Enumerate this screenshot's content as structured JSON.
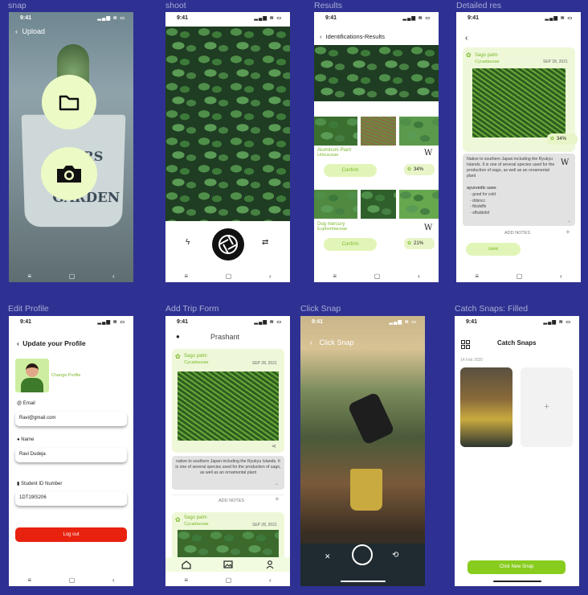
{
  "frames": {
    "snap": "snap",
    "shoot": "shoot",
    "results": "Results",
    "detailed": "Detailed res",
    "edit_profile": "Edit Profile",
    "add_trip": "Add Trip Form",
    "click_snap": "Click Snap",
    "catch_snaps": "Catch Snaps: Filled"
  },
  "status_time": "9:41",
  "status_icons": "▂▄▆ ≋ ▭",
  "nav": {
    "menu": "≡",
    "home": "▢",
    "back": "‹"
  },
  "snap": {
    "back": "‹",
    "title": "Upload",
    "pot_text1": "ERS",
    "pot_text2": "GARDEN"
  },
  "shoot": {
    "flash": "ϟ",
    "flip": "⇄"
  },
  "results": {
    "back": "‹",
    "title": "Identifications-Results",
    "items": [
      {
        "name": "Aluminum Plant",
        "family": "Urticaceae",
        "confirm": "Confirm",
        "pct": "34%",
        "wiki": "W"
      },
      {
        "name": "Dog mercury",
        "family": "Euphorbiaceae",
        "confirm": "Confirm",
        "pct": "21%",
        "wiki": "W"
      }
    ]
  },
  "detail": {
    "back": "‹",
    "name": "Sago palm",
    "family": "Cycadaceae",
    "date": "SEP 28, 2021",
    "pct": "34%",
    "description": "Native to southern Japan including the Ryukyu Islands. It is one of several species used for the production of sago, as well as an ornamental plant",
    "uses_title": "ayurvedic uses",
    "uses": [
      "good for cold",
      "ddsncc",
      "fdsdsffs",
      "sffsddsfsf"
    ],
    "add_notes": "ADD NOTES",
    "plus": "+",
    "save": "save",
    "wiki": "W"
  },
  "profile": {
    "back": "‹",
    "title": "Update your Profile",
    "change": "Change Profile",
    "email_label": "Email",
    "email": "Ravi@gmail.com",
    "name_label": "Name",
    "name": "Ravi Dudeja",
    "sid_label": "Student ID Number",
    "sid": "1DT19IS206",
    "logout": "Log out"
  },
  "trip": {
    "user": "Prashant",
    "card1": {
      "name": "Sago palm",
      "family": "Cycadaceae",
      "date": "SEP 28, 2021"
    },
    "description": "native to southern Japan including the Ryukyu Islands. It is one of several species used for the production of sago, as well as an ornamental plant",
    "add_notes": "ADD NOTES",
    "plus": "+",
    "card2": {
      "name": "Sago palm",
      "family": "Cycadaceae",
      "date": "SEP 28, 2021"
    }
  },
  "click": {
    "back": "‹",
    "title": "Click Snap",
    "flash_off": "✕",
    "flip": "⟲"
  },
  "catch": {
    "title": "Catch Snaps",
    "date": "14 Feb 2020",
    "plus": "+",
    "button": "Click New Snap"
  },
  "colors": {
    "bg": "#2e3192",
    "accent": "#7bb82a",
    "logout": "#e8220f",
    "green_btn": "#88cc1e"
  }
}
